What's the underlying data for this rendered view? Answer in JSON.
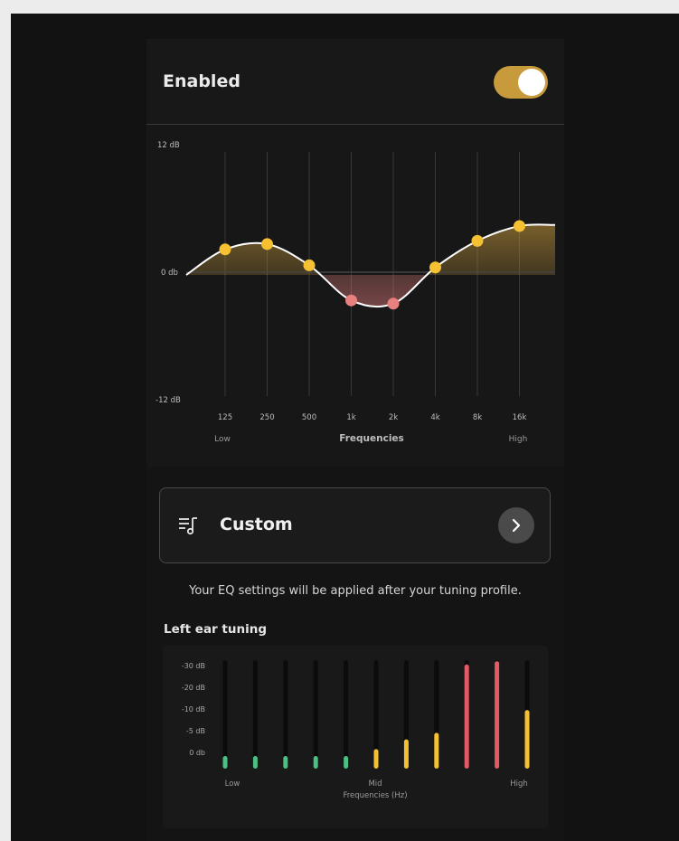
{
  "header": {
    "enabled_label": "Enabled",
    "toggle_on": true,
    "toggle_color": "#c79a3c"
  },
  "chart_data": [
    {
      "type": "line",
      "title": "",
      "xlabel": "Frequencies",
      "x_tick_labels": [
        "125",
        "250",
        "500",
        "1k",
        "2k",
        "4k",
        "8k",
        "16k"
      ],
      "x_range_labels": {
        "low": "Low",
        "high": "High"
      },
      "y_tick_labels": [
        "12 dB",
        "0 db",
        "-12 dB"
      ],
      "ylim": [
        -12,
        12
      ],
      "y_values": [
        2.4,
        2.9,
        0.9,
        -2.4,
        -2.7,
        0.7,
        3.2,
        4.6
      ],
      "colors": {
        "boost": "#f5c031",
        "cut": "#e98080",
        "line": "#ffffff"
      }
    },
    {
      "type": "bar",
      "title": "Left ear tuning",
      "xlabel": "Frequencies (Hz)",
      "x_range_labels": {
        "low": "Low",
        "mid": "Mid",
        "high": "High"
      },
      "y_tick_labels": [
        "-30 dB",
        "-20 dB",
        "-10 dB",
        "-5 dB",
        "0 db"
      ],
      "values": [
        -2,
        0,
        -1,
        -1,
        -1,
        -6,
        -9,
        -11,
        -32,
        -33,
        -18
      ],
      "bar_colors": [
        "#4cbf82",
        "#4cbf82",
        "#4cbf82",
        "#4cbf82",
        "#4cbf82",
        "#f5c031",
        "#f5c031",
        "#f5c031",
        "#e25a63",
        "#e25a63",
        "#f5c031"
      ]
    }
  ],
  "preset": {
    "label": "Custom",
    "icon": "playlist-music-icon",
    "chevron_icon": "chevron-right-icon"
  },
  "note": "Your EQ settings will be applied after your tuning profile."
}
